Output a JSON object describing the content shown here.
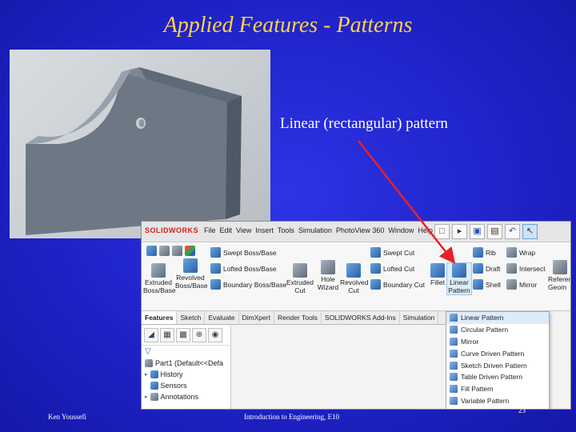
{
  "slide": {
    "title": "Applied Features - Patterns",
    "callout": "Linear (rectangular) pattern",
    "footer_left": "Ken Youssefi",
    "footer_center": "Introduction to Engineering, E10",
    "footer_right": "23"
  },
  "colors": {
    "title": "#ffd24a",
    "background": "#1f23c8",
    "arrow": "#e8202a"
  },
  "solidworks": {
    "logo": "SOLIDWORKS",
    "menu": [
      "File",
      "Edit",
      "View",
      "Insert",
      "Tools",
      "Simulation",
      "PhotoView 360",
      "Window",
      "Help"
    ],
    "ribbon": {
      "extruded_boss": "Extruded Boss/Base",
      "revolved_boss": "Revolved Boss/Base",
      "swept_boss": "Swept Boss/Base",
      "lofted_boss": "Lofted Boss/Base",
      "boundary_boss": "Boundary Boss/Base",
      "extruded_cut": "Extruded Cut",
      "hole_wizard": "Hole Wizard",
      "revolved_cut": "Revolved Cut",
      "swept_cut": "Swept Cut",
      "lofted_cut": "Lofted Cut",
      "boundary_cut": "Boundary Cut",
      "fillet": "Fillet",
      "linear_pattern": "Linear Pattern",
      "rib": "Rib",
      "draft": "Draft",
      "shell": "Shell",
      "wrap": "Wrap",
      "intersect": "Intersect",
      "mirror": "Mirror",
      "reference_geometry": "Reference Geom"
    },
    "tabs": [
      "Features",
      "Sketch",
      "Evaluate",
      "DimXpert",
      "Render Tools",
      "SOLIDWORKS Add-Ins",
      "Simulation"
    ],
    "active_tab": "Features",
    "tree": {
      "part": "Part1 (Default<<Defa",
      "items": [
        "History",
        "Sensors",
        "Annotations"
      ]
    },
    "pattern_menu": [
      "Linear Pattern",
      "Circular Pattern",
      "Mirror",
      "Curve Driven Pattern",
      "Sketch Driven Pattern",
      "Table Driven Pattern",
      "Fill Pattern",
      "Variable Pattern"
    ]
  }
}
